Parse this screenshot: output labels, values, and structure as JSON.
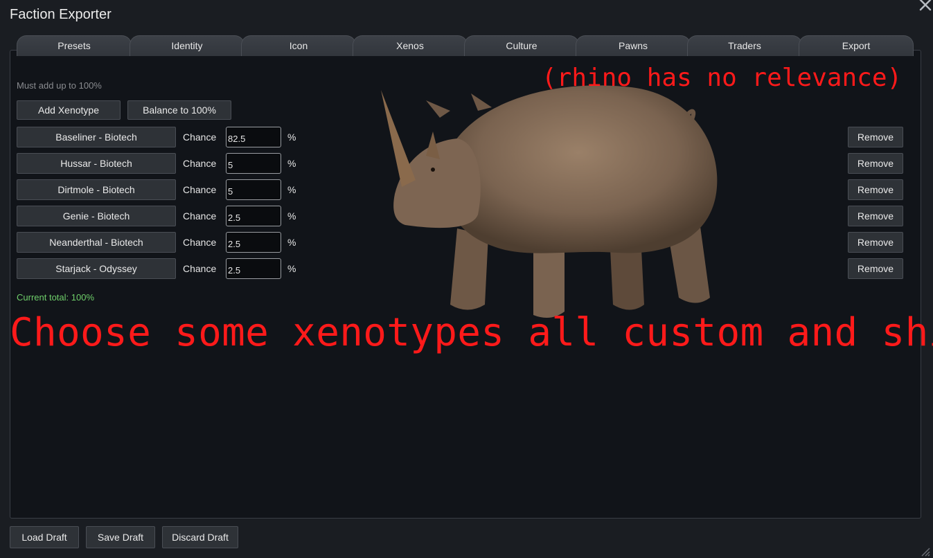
{
  "window": {
    "title": "Faction Exporter"
  },
  "tabs": [
    "Presets",
    "Identity",
    "Icon",
    "Xenos",
    "Culture",
    "Pawns",
    "Traders",
    "Export"
  ],
  "xenos": {
    "hint": "Must add up to 100%",
    "add_label": "Add Xenotype",
    "balance_label": "Balance to 100%",
    "chance_label": "Chance",
    "percent_sign": "%",
    "remove_label": "Remove",
    "rows": [
      {
        "name": "Baseliner - Biotech",
        "value": "82.5"
      },
      {
        "name": "Hussar - Biotech",
        "value": "5"
      },
      {
        "name": "Dirtmole - Biotech",
        "value": "5"
      },
      {
        "name": "Genie - Biotech",
        "value": "2.5"
      },
      {
        "name": "Neanderthal - Biotech",
        "value": "2.5"
      },
      {
        "name": "Starjack - Odyssey",
        "value": "2.5"
      }
    ],
    "total": "Current total: 100%"
  },
  "overlay": {
    "top_note": "(rhino has no relevance)",
    "caption": "Choose some xenotypes all custom and shit"
  },
  "footer": {
    "load_label": "Load Draft",
    "save_label": "Save Draft",
    "discard_label": "Discard Draft"
  },
  "colors": {
    "background": "#1a1d22",
    "panel": "#111419",
    "accent_green": "#6fcf6a",
    "overlay_red": "#ff1a1a"
  },
  "icons": [
    "close-icon",
    "rhino-image",
    "resize-grip-icon"
  ]
}
